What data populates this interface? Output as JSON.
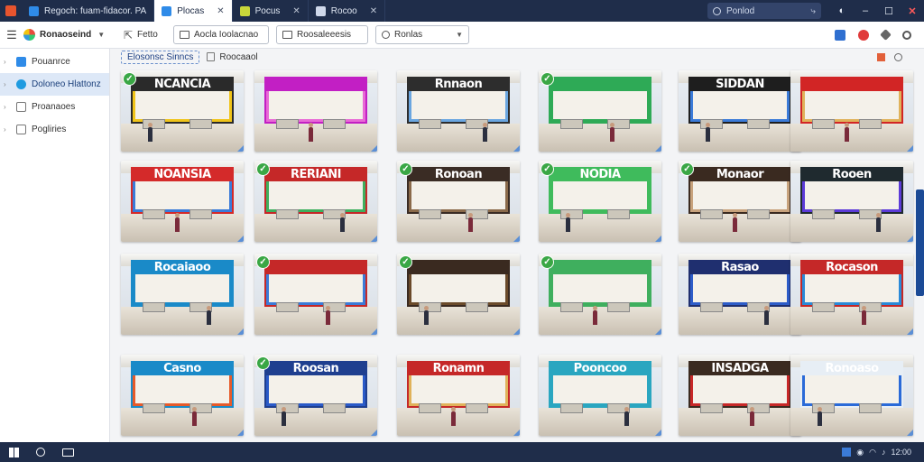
{
  "tabs": [
    {
      "label": "Regoch: fuam-fidacor. PA",
      "active": false,
      "color": "#2f8be8"
    },
    {
      "label": "Plocas",
      "active": true,
      "color": "#2f8be8"
    },
    {
      "label": "Pocus",
      "active": false,
      "color": "#c8d63a"
    },
    {
      "label": "Rocoo",
      "active": false,
      "color": "#cfd8ea"
    }
  ],
  "top_search": {
    "label": "Ponlod"
  },
  "window_controls": {
    "minimize": "–",
    "maximize": "☐",
    "close": "✕"
  },
  "toolbar": {
    "account": "Ronaoseind",
    "back_label": "Fetto",
    "btn1": "Aocla Ioolacnao",
    "btn2": "Roosaleeesis",
    "btn3": "Ronlas"
  },
  "sidebar": {
    "items": [
      {
        "label": "Pouanrce",
        "active": false,
        "icon_color": "#2f8be8"
      },
      {
        "label": "Doloneo Hlattonz",
        "active": true,
        "icon_color": "#1f9be0"
      },
      {
        "label": "Proanaoes",
        "active": false,
        "icon_color": "#777"
      },
      {
        "label": "Pogliries",
        "active": false,
        "icon_color": "#777"
      }
    ]
  },
  "subheader": {
    "pill": "Elosonsc Sinncs",
    "crumb": "Roocaaol"
  },
  "gallery": {
    "rows": [
      [
        {
          "sign": "NCANCIA",
          "sign_color": "#2a2a2a",
          "checked": true,
          "accent": "#f0c419"
        },
        {
          "sign": "",
          "sign_color": "#c21fc4",
          "checked": false,
          "accent": "#e86ad6"
        },
        {
          "sign": "Rnnaon",
          "sign_color": "#2d2d2d",
          "checked": false,
          "accent": "#6aa6e0"
        },
        {
          "sign": "",
          "sign_color": "#2eaa56",
          "checked": true,
          "accent": "#2eaa56"
        },
        {
          "sign": "SIDDAN",
          "sign_color": "#1e1e1e",
          "checked": false,
          "accent": "#3b7bd8"
        },
        {
          "sign": "",
          "sign_color": "#d22525",
          "checked": false,
          "accent": "#e0b25a"
        }
      ],
      [
        {
          "sign": "NOANSIA",
          "sign_color": "#d42a2a",
          "checked": false,
          "accent": "#3b7bd8"
        },
        {
          "sign": "RERIANI",
          "sign_color": "#c52828",
          "checked": true,
          "accent": "#3faf5e"
        },
        {
          "sign": "Ronoan",
          "sign_color": "#3a2c24",
          "checked": true,
          "accent": "#8a6a4a"
        },
        {
          "sign": "NODIA",
          "sign_color": "#3fbb5c",
          "checked": true,
          "accent": "#3fbb5c"
        },
        {
          "sign": "Monaor",
          "sign_color": "#3a2a20",
          "checked": true,
          "accent": "#c7a27c"
        },
        {
          "sign": "Rooen",
          "sign_color": "#1f2a2f",
          "checked": false,
          "accent": "#5c3bd8"
        }
      ],
      [
        {
          "sign": "Rocaiaoo",
          "sign_color": "#1a8ac8",
          "checked": false,
          "accent": "#1a8ac8"
        },
        {
          "sign": "",
          "sign_color": "#c52828",
          "checked": true,
          "accent": "#3b7bd8"
        },
        {
          "sign": "",
          "sign_color": "#3a2a20",
          "checked": true,
          "accent": "#6a4a2a"
        },
        {
          "sign": "",
          "sign_color": "#3faf5e",
          "checked": true,
          "accent": "#3faf5e"
        },
        {
          "sign": "Rasao",
          "sign_color": "#1f2f6f",
          "checked": false,
          "accent": "#2d5cc8"
        },
        {
          "sign": "Rocason",
          "sign_color": "#c52828",
          "checked": false,
          "accent": "#2a8ad8"
        }
      ],
      [
        {
          "sign": "Casno",
          "sign_color": "#1a8ac8",
          "checked": false,
          "accent": "#e65a2a"
        },
        {
          "sign": "Roosan",
          "sign_color": "#1f3f8f",
          "checked": true,
          "accent": "#2a5ac8"
        },
        {
          "sign": "Ronamn",
          "sign_color": "#c52828",
          "checked": false,
          "accent": "#e0b25a"
        },
        {
          "sign": "Pooncoo",
          "sign_color": "#2aa6c0",
          "checked": false,
          "accent": "#2aa6c0"
        },
        {
          "sign": "INSADGA",
          "sign_color": "#3a2a20",
          "checked": false,
          "accent": "#c72828"
        },
        {
          "sign": "Ronoaso",
          "sign_color": "#e7eef5",
          "checked": false,
          "accent": "#2a6ad8"
        }
      ]
    ]
  },
  "taskbar": {
    "tray_text": "12:00"
  }
}
